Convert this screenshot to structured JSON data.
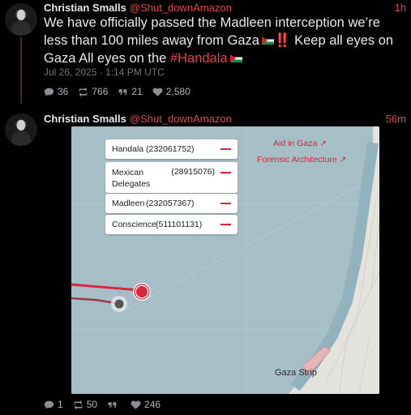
{
  "tweet1": {
    "author_name": "Christian Smalls",
    "handle": "@Shut_downAmazon",
    "time": "1h",
    "text_main": "We have officially passed the Madleen interception we’re less than 100 miles away from Gaza",
    "text_after": " Keep all eyes on Gaza All eyes on the ",
    "bang": "‼️",
    "hashtag": "#Handala",
    "date": "Jul 26, 2025 · 1:14 PM UTC",
    "stats": {
      "replies": "36",
      "retweets": "766",
      "quotes": "21",
      "likes": "2,580"
    }
  },
  "tweet2": {
    "author_name": "Christian Smalls",
    "handle": "@Shut_downAmazon",
    "time": "56m",
    "map": {
      "legend": [
        {
          "name": "Handala",
          "mmsi": "(232061752)"
        },
        {
          "name": "Mexican Delegates",
          "mmsi": "(28915076)"
        },
        {
          "name": "Madleen",
          "mmsi": "(232057367)"
        },
        {
          "name": "Conscience",
          "mmsi": "(511101131)"
        }
      ],
      "link_aid": "Aid in Gaza ↗",
      "link_forensic": "Forensic Architecture ↗",
      "place_label": "Gaza Strip",
      "colors": {
        "sea": "#a6bfc7",
        "land": "#e4e2dc",
        "track": "#d7263d"
      }
    },
    "stats": {
      "replies": "1",
      "retweets": "50",
      "quotes": "",
      "likes": "246"
    }
  },
  "colors": {
    "accent": "#e0464a",
    "background": "#000000",
    "text": "#e7e9ea"
  }
}
